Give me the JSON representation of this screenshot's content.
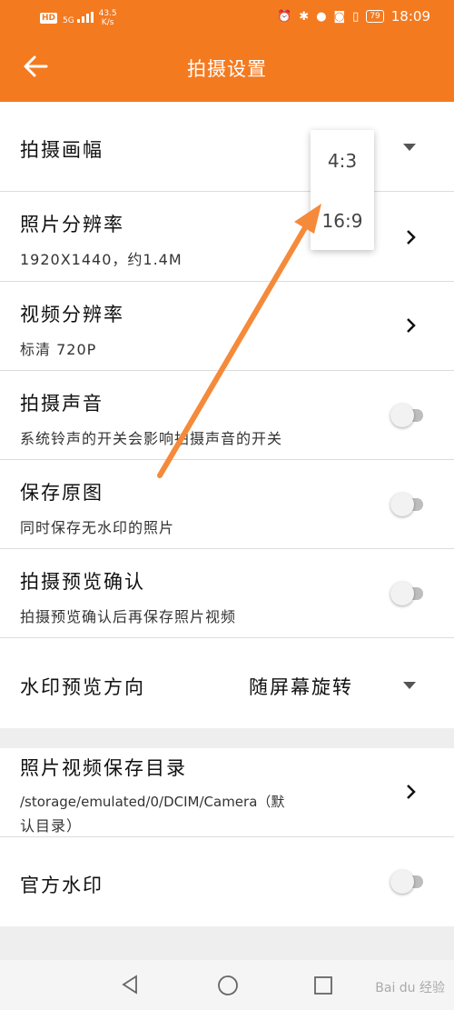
{
  "status_bar": {
    "hd": "HD",
    "signal": "5G",
    "speed_value": "43.5",
    "speed_unit": "K/s",
    "battery": "79",
    "time": "18:09"
  },
  "header": {
    "title": "拍摄设置"
  },
  "settings": {
    "frame": {
      "title": "拍摄画幅"
    },
    "photo_res": {
      "title": "照片分辨率",
      "subtitle": "1920X1440，约1.4M"
    },
    "video_res": {
      "title": "视频分辨率",
      "subtitle": "标清 720P"
    },
    "sound": {
      "title": "拍摄声音",
      "subtitle": "系统铃声的开关会影响拍摄声音的开关",
      "enabled": false
    },
    "save_original": {
      "title": "保存原图",
      "subtitle": "同时保存无水印的照片",
      "enabled": false
    },
    "preview_confirm": {
      "title": "拍摄预览确认",
      "subtitle": "拍摄预览确认后再保存照片视频",
      "enabled": false
    },
    "watermark_direction": {
      "title": "水印预览方向",
      "value": "随屏幕旋转"
    },
    "save_dir": {
      "title": "照片视频保存目录",
      "subtitle_line1": "/storage/emulated/0/DCIM/Camera（默",
      "subtitle_line2": "认目录）"
    },
    "official_watermark": {
      "title": "官方水印",
      "enabled": false
    }
  },
  "frame_dropdown": {
    "options": [
      "4:3",
      "16:9"
    ]
  },
  "colors": {
    "accent": "#f47a20",
    "annotation_arrow": "#f58a3a"
  },
  "watermark_text": "Bai du 经验"
}
